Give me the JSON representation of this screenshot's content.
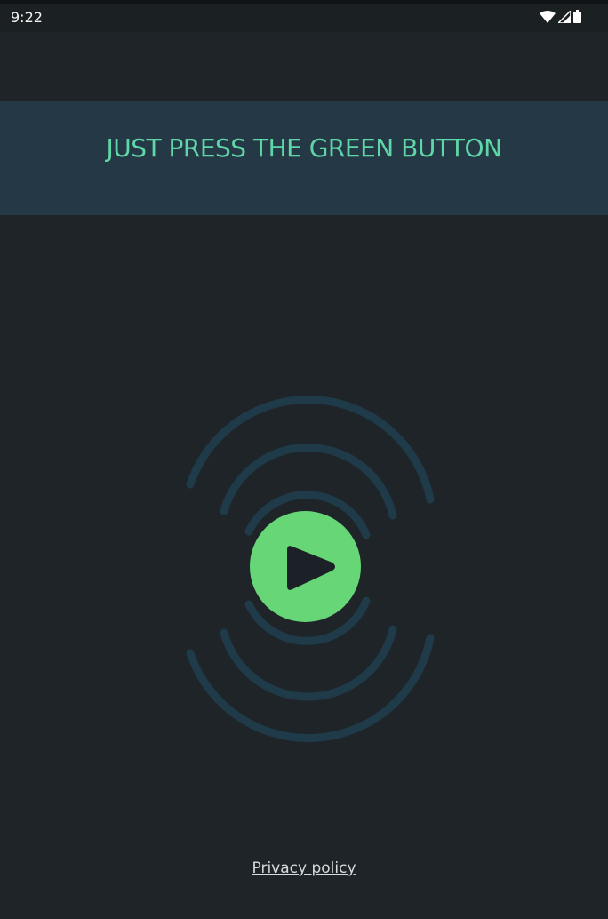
{
  "status_bar": {
    "time": "9:22",
    "icons": [
      "wifi-icon",
      "signal-icon",
      "battery-icon"
    ]
  },
  "header": {
    "title": "JUST PRESS THE GREEN BUTTON"
  },
  "player": {
    "play_icon": "play-icon",
    "wave_icon": "sound-waves-icon"
  },
  "footer": {
    "privacy_label": "Privacy policy"
  },
  "colors": {
    "background": "#1e2428",
    "header_band": "#243845",
    "title_text": "#5fd6a7",
    "play_button": "#66d677",
    "waves": "#1f3a48"
  }
}
